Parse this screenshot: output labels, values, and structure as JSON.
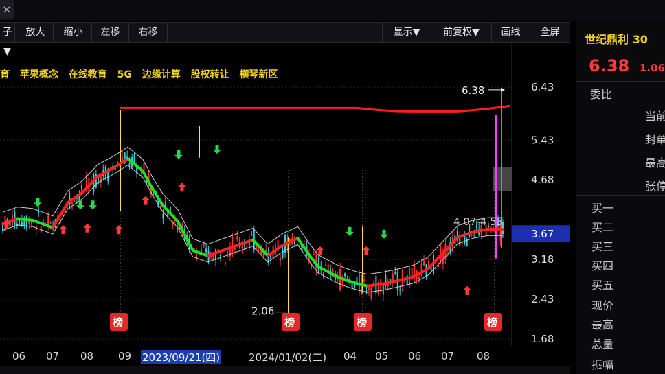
{
  "tab": {
    "close_glyph": "×"
  },
  "toolbar": {
    "left_partial": "子▼",
    "zoom_in": "放大",
    "zoom_out": "缩小",
    "move_left": "左移",
    "move_right": "右移",
    "display": "显示▼",
    "adjust": "前复权▼",
    "draw": "画线",
    "fullscreen": "全屏"
  },
  "concepts": [
    "育",
    "苹果概念",
    "在线教育",
    "5G",
    "边缘计算",
    "股权转让",
    "横琴新区"
  ],
  "price_axis": {
    "ticks": [
      "6.43",
      "5.43",
      "4.68",
      "3.18",
      "2.43",
      "1.68"
    ],
    "current": "3.67",
    "current_color": "#1c2fb0"
  },
  "annotations": {
    "high_label": "6.38",
    "low_label": "2.06",
    "range_label": "4.07-4.53",
    "board_badge": "榜"
  },
  "time_axis": {
    "labels": [
      "06",
      "07",
      "08",
      "09",
      "2023/09/21(四)",
      "2024/01/02(二)",
      "04",
      "05",
      "06",
      "07",
      "08"
    ],
    "selected": "2023/09/21(四)"
  },
  "chart_data": {
    "type": "candlestick",
    "title": "",
    "ylabel": "",
    "xlabel": "",
    "ylim": [
      1.68,
      6.43
    ],
    "y_ticks": [
      6.43,
      5.43,
      4.68,
      3.18,
      2.43,
      1.68
    ],
    "current_price": 3.67,
    "period_high": 6.38,
    "period_low": 2.06,
    "range_annotation": [
      4.07,
      4.53
    ],
    "overlay_top_line": 6.05,
    "trend_line": {
      "x": [
        0,
        3,
        6,
        8,
        10,
        13,
        16,
        19,
        22,
        25,
        28,
        30,
        32,
        35,
        38,
        41,
        44,
        47,
        50,
        53,
        56,
        59,
        61,
        63,
        65,
        67,
        69,
        71,
        73,
        76,
        79,
        82,
        85,
        88,
        91,
        94,
        97,
        99,
        100
      ],
      "values": [
        3.85,
        3.95,
        3.92,
        3.85,
        3.78,
        4.25,
        4.45,
        4.75,
        4.9,
        5.08,
        4.85,
        4.5,
        4.2,
        3.9,
        3.35,
        3.25,
        3.35,
        3.45,
        3.55,
        3.25,
        3.45,
        3.58,
        3.3,
        3.05,
        2.95,
        2.85,
        2.78,
        2.72,
        2.68,
        2.72,
        2.78,
        2.85,
        3.0,
        3.3,
        3.6,
        3.7,
        3.75,
        3.75,
        3.75
      ]
    }
  },
  "colors": {
    "up": "#ff3333",
    "down": "#2ad6e6",
    "ma_up": "#ff2020",
    "ma_down": "#22e022",
    "concept": "#f2d21e"
  },
  "icons": {
    "up_arrow": "up-arrow-icon",
    "down_arrow": "down-arrow-icon",
    "close": "close-icon"
  },
  "panel": {
    "stock_name": "世纪鼎利 30",
    "price": "6.38",
    "change": "1.06",
    "weibi": "委比",
    "dangqian": "当前",
    "fengdan": "封单",
    "zuigao_lbl": "最高",
    "zhangting": "张停",
    "bids": [
      "买一",
      "买二",
      "买三",
      "买四",
      "买五"
    ],
    "stats": [
      "现价",
      "最高",
      "总量",
      "振幅"
    ]
  }
}
